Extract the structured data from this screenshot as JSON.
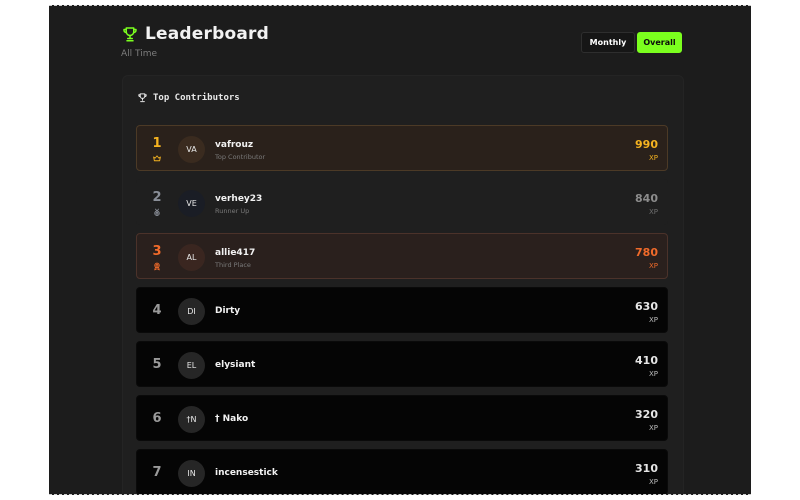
{
  "header": {
    "title": "Leaderboard",
    "subtitle": "All Time"
  },
  "toggle": {
    "monthly_label": "Monthly",
    "overall_label": "Overall",
    "active": "Overall"
  },
  "panel": {
    "title": "Top Contributors"
  },
  "colors": {
    "accent": "#7bff1e",
    "gold": "#f5b320",
    "silver": "#8a8f98",
    "bronze": "#f06a2a"
  },
  "entries": [
    {
      "rank": "1",
      "initials": "VA",
      "name": "vafrouz",
      "role": "Top Contributor",
      "score": "990",
      "unit": "XP",
      "tier": "gold",
      "medal_icon": "crown-icon"
    },
    {
      "rank": "2",
      "initials": "VE",
      "name": "verhey23",
      "role": "Runner Up",
      "score": "840",
      "unit": "XP",
      "tier": "silver",
      "medal_icon": "medal-icon"
    },
    {
      "rank": "3",
      "initials": "AL",
      "name": "allie417",
      "role": "Third Place",
      "score": "780",
      "unit": "XP",
      "tier": "bronze",
      "medal_icon": "award-icon"
    },
    {
      "rank": "4",
      "initials": "DI",
      "name": "Dirty",
      "role": "",
      "score": "630",
      "unit": "XP",
      "tier": "plain"
    },
    {
      "rank": "5",
      "initials": "EL",
      "name": "elysiant",
      "role": "",
      "score": "410",
      "unit": "XP",
      "tier": "plain"
    },
    {
      "rank": "6",
      "initials": "†N",
      "name": "† Nako",
      "role": "",
      "score": "320",
      "unit": "XP",
      "tier": "plain"
    },
    {
      "rank": "7",
      "initials": "IN",
      "name": "incensestick",
      "role": "",
      "score": "310",
      "unit": "XP",
      "tier": "plain"
    }
  ]
}
